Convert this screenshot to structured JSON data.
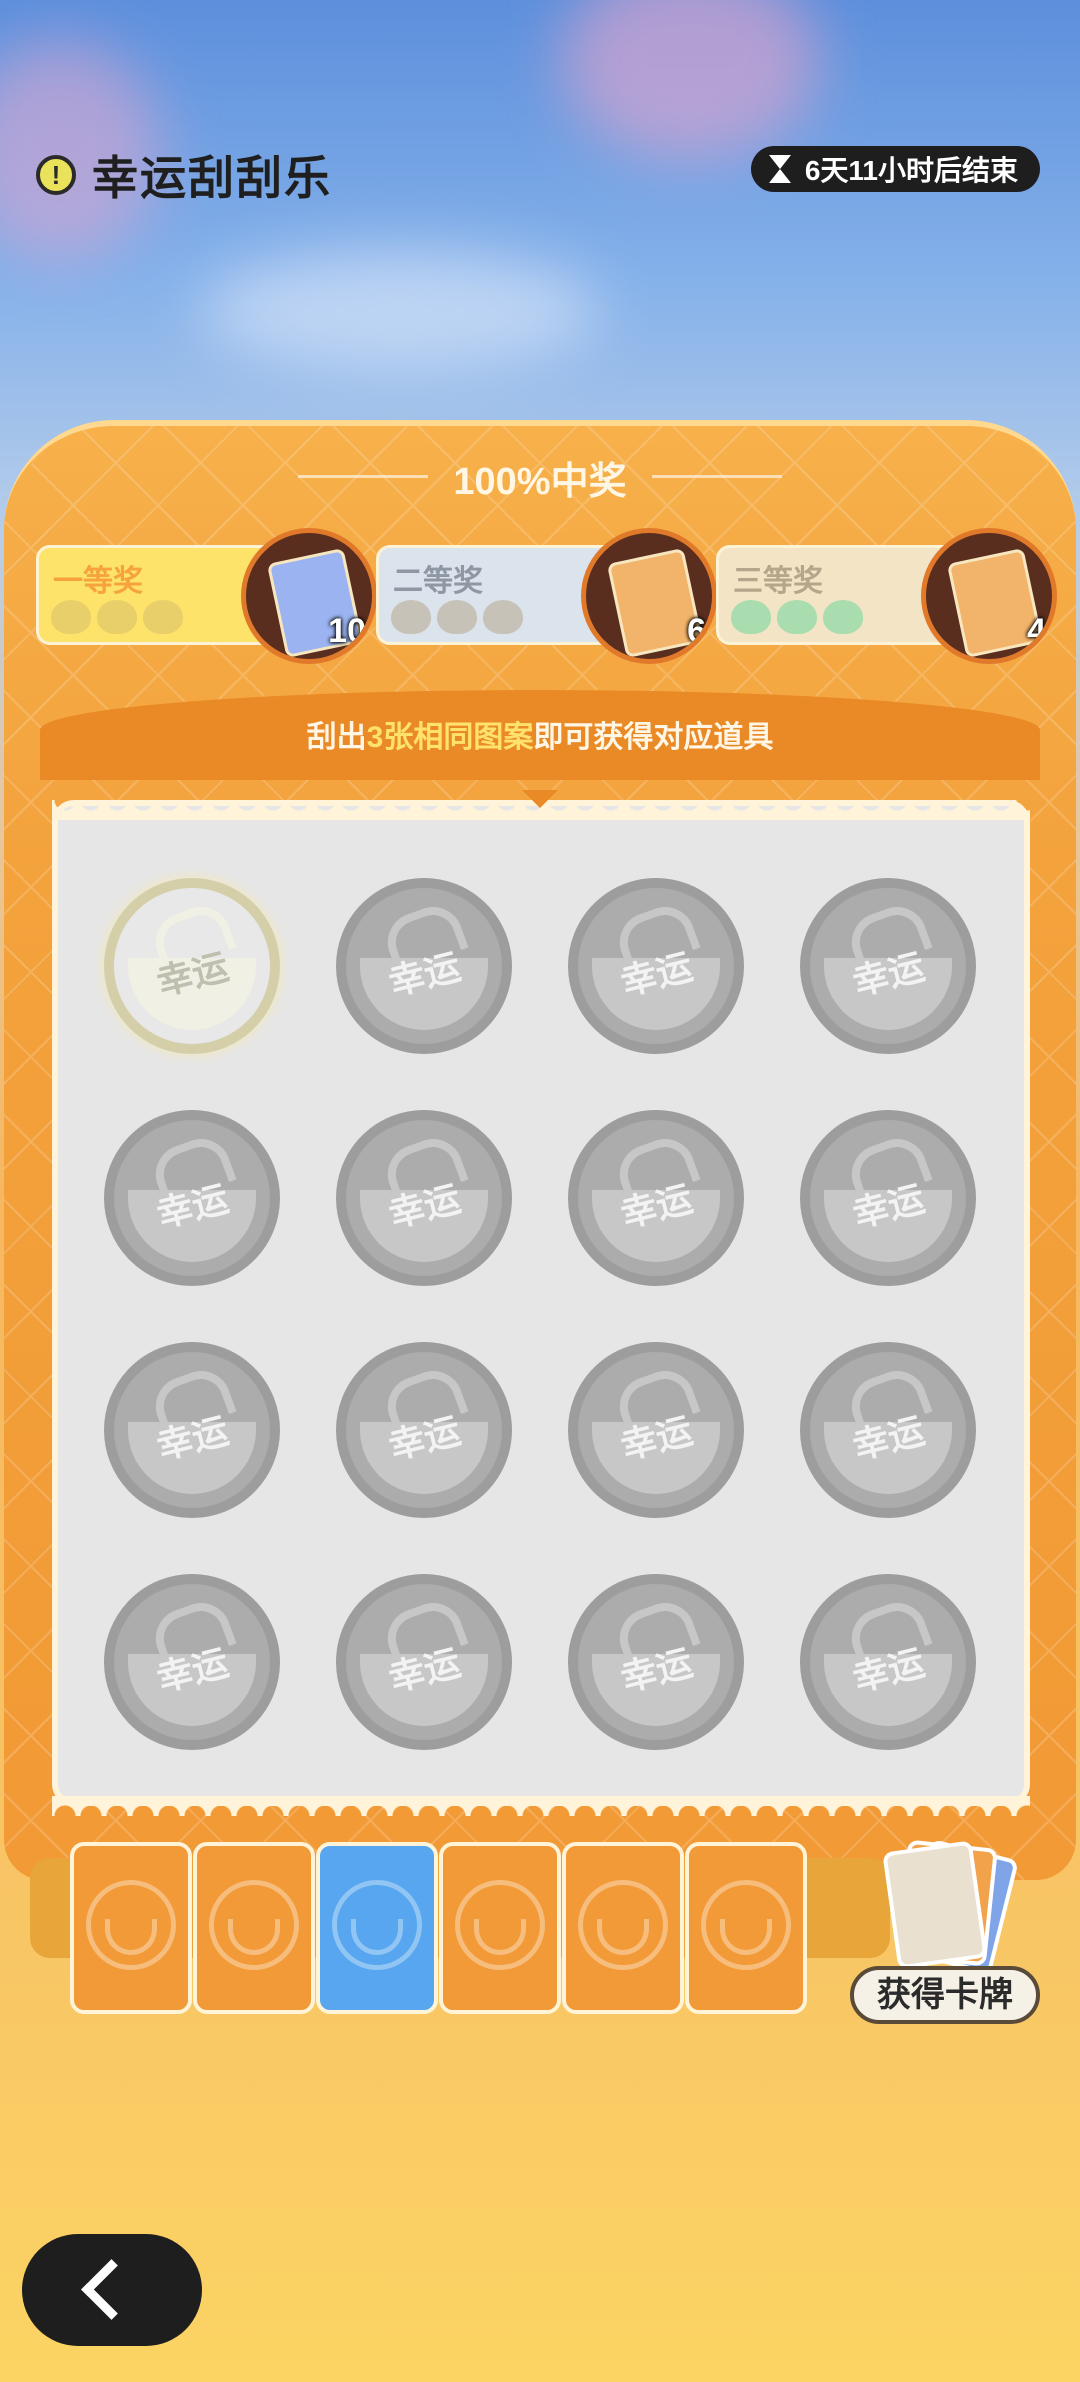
{
  "header": {
    "title": "幸运刮刮乐",
    "timer_text": "6天11小时后结束"
  },
  "panel": {
    "win_label": "100%中奖",
    "prizes": [
      {
        "label": "一等奖",
        "count": "10",
        "bg": "#fde36a",
        "label_color": "#f5a33a",
        "face_color": "#e9cf6a",
        "card_color": "#9bb3f0"
      },
      {
        "label": "二等奖",
        "count": "6",
        "bg": "#dbe3ec",
        "label_color": "#8e97a3",
        "face_color": "#c7c2b7",
        "card_color": "#f2b46a"
      },
      {
        "label": "三等奖",
        "count": "4",
        "bg": "#f3e4c6",
        "label_color": "#b5a58a",
        "face_color": "#a9dcae",
        "card_color": "#f2b46a"
      }
    ],
    "hint_prefix": "刮出",
    "hint_highlight": "3张相同图案",
    "hint_suffix": "即可获得对应道具"
  },
  "board": {
    "cell_text": "幸运",
    "rows": 4,
    "cols": 4,
    "active_cell": 0
  },
  "tray": {
    "cards": [
      "orange",
      "orange",
      "blue",
      "orange",
      "orange",
      "orange"
    ],
    "get_cards_label": "获得卡牌"
  },
  "colors": {
    "accent": "#f29a35",
    "highlight": "#ffe26b"
  },
  "icons": {
    "warning": "warning-icon",
    "timer": "hourglass-icon",
    "back": "chevron-left-icon"
  }
}
